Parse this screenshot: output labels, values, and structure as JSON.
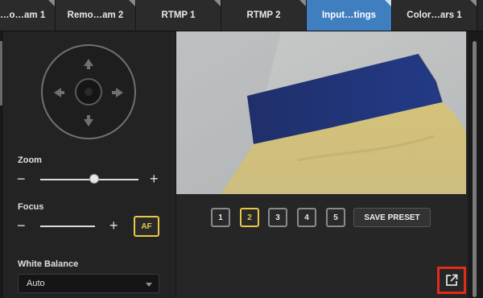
{
  "tabs": [
    {
      "label": "…o…am 1",
      "active": false
    },
    {
      "label": "Remo…am 2",
      "active": false
    },
    {
      "label": "RTMP 1",
      "active": false
    },
    {
      "label": "RTMP 2",
      "active": false
    },
    {
      "label": "Input…tings",
      "active": true
    },
    {
      "label": "Color…ars 1",
      "active": false
    }
  ],
  "controls": {
    "zoom_label": "Zoom",
    "focus_label": "Focus",
    "minus": "−",
    "plus": "+",
    "af_label": "AF",
    "zoom_level": 0.55,
    "white_balance_label": "White Balance",
    "white_balance_value": "Auto"
  },
  "presets": {
    "buttons": [
      "1",
      "2",
      "3",
      "4",
      "5"
    ],
    "selected": "2",
    "save_label": "SAVE PRESET"
  },
  "icons": {
    "ptz": "ptz-directional-pad-icon",
    "external": "open-external-icon"
  },
  "colors": {
    "active_tab": "#3f7fbf",
    "highlight": "#e8c84a",
    "external_outline": "#e32b1a"
  }
}
